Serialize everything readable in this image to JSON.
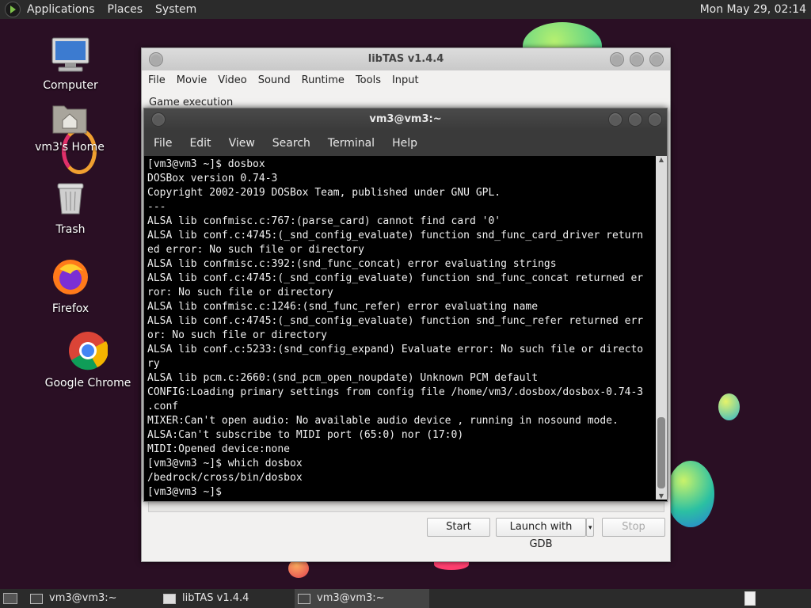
{
  "top_panel": {
    "menus": [
      "Applications",
      "Places",
      "System"
    ],
    "clock": "Mon May 29, 02:14"
  },
  "desktop_icons": [
    {
      "label": "Computer",
      "icon": "computer-icon"
    },
    {
      "label": "vm3's Home",
      "icon": "home-folder-icon"
    },
    {
      "label": "Trash",
      "icon": "trash-icon"
    },
    {
      "label": "Firefox",
      "icon": "firefox-icon"
    },
    {
      "label": "Google Chrome",
      "icon": "chrome-icon"
    }
  ],
  "libtas": {
    "title": "libTAS v1.4.4",
    "menu": [
      "File",
      "Movie",
      "Video",
      "Sound",
      "Runtime",
      "Tools",
      "Input"
    ],
    "section_label": "Game execution",
    "buttons": {
      "start": "Start",
      "launch_gdb": "Launch with GDB",
      "stop": "Stop"
    }
  },
  "terminal": {
    "title": "vm3@vm3:~",
    "menu": [
      "File",
      "Edit",
      "View",
      "Search",
      "Terminal",
      "Help"
    ],
    "lines": [
      "[vm3@vm3 ~]$ dosbox",
      "DOSBox version 0.74-3",
      "Copyright 2002-2019 DOSBox Team, published under GNU GPL.",
      "---",
      "ALSA lib confmisc.c:767:(parse_card) cannot find card '0'",
      "ALSA lib conf.c:4745:(_snd_config_evaluate) function snd_func_card_driver return",
      "ed error: No such file or directory",
      "ALSA lib confmisc.c:392:(snd_func_concat) error evaluating strings",
      "ALSA lib conf.c:4745:(_snd_config_evaluate) function snd_func_concat returned er",
      "ror: No such file or directory",
      "ALSA lib confmisc.c:1246:(snd_func_refer) error evaluating name",
      "ALSA lib conf.c:4745:(_snd_config_evaluate) function snd_func_refer returned err",
      "or: No such file or directory",
      "ALSA lib conf.c:5233:(snd_config_expand) Evaluate error: No such file or directo",
      "ry",
      "ALSA lib pcm.c:2660:(snd_pcm_open_noupdate) Unknown PCM default",
      "CONFIG:Loading primary settings from config file /home/vm3/.dosbox/dosbox-0.74-3",
      ".conf",
      "MIXER:Can't open audio: No available audio device , running in nosound mode.",
      "ALSA:Can't subscribe to MIDI port (65:0) nor (17:0)",
      "MIDI:Opened device:none",
      "[vm3@vm3 ~]$ which dosbox",
      "/bedrock/cross/bin/dosbox",
      "[vm3@vm3 ~]$ "
    ]
  },
  "taskbar": {
    "tasks": [
      {
        "label": "vm3@vm3:~",
        "active": false
      },
      {
        "label": "libTAS v1.4.4",
        "active": false
      },
      {
        "label": "vm3@vm3:~",
        "active": true
      }
    ]
  }
}
